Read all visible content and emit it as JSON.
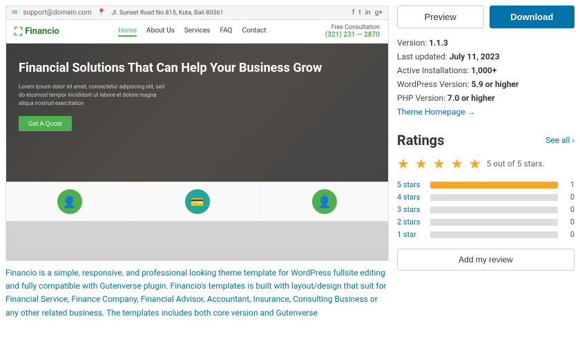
{
  "header": {
    "email": "support@domain.com",
    "location": "Jl. Sunset Road No.815, Kuta, Bali 80361",
    "social": [
      "f",
      "t",
      "in",
      "g+"
    ]
  },
  "nav": {
    "logo": "Financio",
    "logo_icon": "₩",
    "links": [
      "Home",
      "About Us",
      "Services",
      "FAQ",
      "Contact"
    ],
    "active_link": "Home",
    "consultation_label": "Free Consultation",
    "phone": "(321) 231 — 2870"
  },
  "hero": {
    "headline": "Financial Solutions That Can Help Your Business Grow",
    "body": "Lorem ipsum dolor sit amet, consectetur adipiscing elit, sed do eiusmod tempor incididunt ut labore et dolore magna aliqua nostrud exercitation",
    "cta_label": "Get A Quote"
  },
  "bottom_cards": [
    {
      "icon": "👤",
      "color": "green"
    },
    {
      "icon": "💳",
      "color": "teal"
    },
    {
      "icon": "👤",
      "color": "green"
    }
  ],
  "description": "Financio is a simple, responsive, and professional looking theme template for WordPress fullsite editing and fully compatible with Gutenverse plugin. Financio's templates is built with layout/design that suit for Financial Service, Finance Company, Financial Advisor, Accountant, Insurance, Consulting Business or any other related business. The templates includes both core version and Gutenverse",
  "actions": {
    "preview_label": "Preview",
    "download_label": "Download"
  },
  "meta": {
    "version_label": "Version:",
    "version_value": "1.1.3",
    "last_updated_label": "Last updated:",
    "last_updated_value": "July 11, 2023",
    "active_installs_label": "Active Installations:",
    "active_installs_value": "1,000+",
    "wp_version_label": "WordPress Version:",
    "wp_version_value": "5.9 or higher",
    "php_version_label": "PHP Version:",
    "php_version_value": "7.0 or higher",
    "theme_homepage_label": "Theme Homepage →"
  },
  "ratings": {
    "title": "Ratings",
    "see_all_label": "See all",
    "stars_count": 5,
    "summary_label": "5 out of 5 stars.",
    "bars": [
      {
        "label": "5 stars",
        "fill_pct": 100,
        "count": 1
      },
      {
        "label": "4 stars",
        "fill_pct": 0,
        "count": 0
      },
      {
        "label": "3 stars",
        "fill_pct": 0,
        "count": 0
      },
      {
        "label": "2 stars",
        "fill_pct": 0,
        "count": 0
      },
      {
        "label": "1 star",
        "fill_pct": 0,
        "count": 0
      }
    ],
    "add_review_label": "Add my review"
  }
}
